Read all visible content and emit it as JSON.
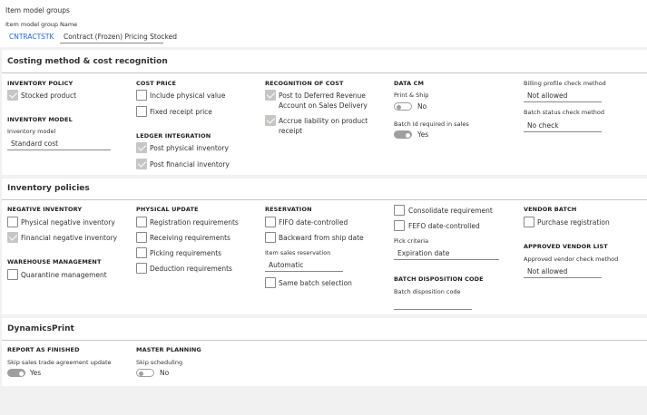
{
  "header": {
    "breadcrumb": "Item model groups",
    "item_model_group_label": "Item model group",
    "item_model_group_value": "CNTRACTSTK",
    "name_label": "Name",
    "name_value": "Contract (Frozen) Pricing Stocked"
  },
  "costing": {
    "title": "Costing method & cost recognition",
    "inventory_policy": {
      "heading": "INVENTORY POLICY",
      "stocked_product": "Stocked product"
    },
    "inventory_model": {
      "heading": "INVENTORY MODEL",
      "field_label": "Inventory model",
      "field_value": "Standard cost"
    },
    "cost_price": {
      "heading": "COST PRICE",
      "include_physical": "Include physical value",
      "fixed_receipt": "Fixed receipt price"
    },
    "ledger_integration": {
      "heading": "LEDGER INTEGRATION",
      "post_physical": "Post physical inventory",
      "post_financial": "Post financial inventory"
    },
    "recognition": {
      "heading": "RECOGNITION OF COST",
      "post_deferred_1": "Post to Deferred Revenue",
      "post_deferred_2": "Account on Sales Delivery",
      "accrue_1": "Accrue liability on product",
      "accrue_2": "receipt"
    },
    "data_cm": {
      "heading": "DATA CM",
      "print_ship_label": "Print & Ship",
      "print_ship_value": "No",
      "batch_id_label": "Batch Id required in sales",
      "batch_id_value": "Yes"
    },
    "billing_profile": {
      "label": "Billing profile check method",
      "value": "Not allowed"
    },
    "batch_status": {
      "label": "Batch status check method",
      "value": "No check"
    }
  },
  "policies": {
    "title": "Inventory policies",
    "negative": {
      "heading": "NEGATIVE INVENTORY",
      "physical": "Physical negative inventory",
      "financial": "Financial negative inventory"
    },
    "warehouse": {
      "heading": "WAREHOUSE MANAGEMENT",
      "quarantine": "Quarantine management"
    },
    "physical_update": {
      "heading": "PHYSICAL UPDATE",
      "registration": "Registration requirements",
      "receiving": "Receiving requirements",
      "picking": "Picking requirements",
      "deduction": "Deduction requirements"
    },
    "reservation": {
      "heading": "RESERVATION",
      "fifo": "FIFO date-controlled",
      "backward": "Backward from ship date",
      "item_sales_label": "Item sales reservation",
      "item_sales_value": "Automatic",
      "same_batch": "Same batch selection"
    },
    "consolidate": "Consolidate requirement",
    "fefo": "FEFO date-controlled",
    "pick_criteria": {
      "label": "Pick criteria",
      "value": "Expiration date"
    },
    "batch_disposition": {
      "heading": "BATCH DISPOSITION CODE",
      "label": "Batch disposition code",
      "value": ""
    },
    "vendor_batch": {
      "heading": "VENDOR BATCH",
      "purchase_registration": "Purchase registration"
    },
    "approved_vendor": {
      "heading": "APPROVED VENDOR LIST",
      "label": "Approved vendor check method",
      "value": "Not allowed"
    }
  },
  "dynamicsprint": {
    "title": "DynamicsPrint",
    "report": {
      "heading": "REPORT AS FINISHED",
      "label": "Skip sales trade agreement update",
      "value": "Yes"
    },
    "master_planning": {
      "heading": "MASTER PLANNING",
      "label": "Skip scheduling",
      "value": "No"
    }
  }
}
